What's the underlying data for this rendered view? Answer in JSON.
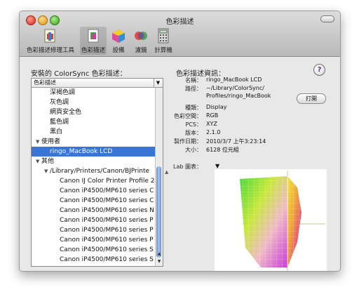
{
  "window": {
    "title": "色彩描述"
  },
  "toolbar": [
    {
      "name": "toolbar-profile-first-aid",
      "label": "色彩描述修理工具"
    },
    {
      "name": "toolbar-profiles",
      "label": "色彩描述"
    },
    {
      "name": "toolbar-devices",
      "label": "設備"
    },
    {
      "name": "toolbar-filters",
      "label": "濾鏡"
    },
    {
      "name": "toolbar-calculator",
      "label": "計算機"
    }
  ],
  "left": {
    "heading": "安裝的 ColorSync 色彩描述：",
    "popup_value": "色彩描述",
    "rows": [
      {
        "text": "深褐色調",
        "indent": 26,
        "disc": ""
      },
      {
        "text": "灰色調",
        "indent": 26,
        "disc": ""
      },
      {
        "text": "網頁安全色",
        "indent": 26,
        "disc": ""
      },
      {
        "text": "藍色調",
        "indent": 26,
        "disc": ""
      },
      {
        "text": "黑白",
        "indent": 26,
        "disc": ""
      },
      {
        "text": "使用者",
        "indent": 6,
        "disc": "▼"
      },
      {
        "text": "ringo_MacBook LCD",
        "indent": 26,
        "disc": "",
        "selected": true
      },
      {
        "text": "其他",
        "indent": 6,
        "disc": "▼"
      },
      {
        "text": "/Library/Printers/Canon/BJPrinte",
        "indent": 18,
        "disc": "▼"
      },
      {
        "text": "Canon IJ Color Printer Profile 2",
        "indent": 40,
        "disc": ""
      },
      {
        "text": "Canon iP4500/MP610 series C",
        "indent": 40,
        "disc": ""
      },
      {
        "text": "Canon iP4500/MP610 series C",
        "indent": 40,
        "disc": ""
      },
      {
        "text": "Canon iP4500/MP610 series N",
        "indent": 40,
        "disc": ""
      },
      {
        "text": "Canon iP4500/MP610 series P",
        "indent": 40,
        "disc": ""
      },
      {
        "text": "Canon iP4500/MP610 series P",
        "indent": 40,
        "disc": ""
      },
      {
        "text": "Canon iP4500/MP610 series P",
        "indent": 40,
        "disc": ""
      },
      {
        "text": "Canon iP4500/MP610 series S",
        "indent": 40,
        "disc": ""
      },
      {
        "text": "Canon iP4500/MP610 series S",
        "indent": 40,
        "disc": ""
      }
    ]
  },
  "right": {
    "heading": "色彩描述資訊：",
    "help_label": "?",
    "open_button": "打開",
    "fields": {
      "name_label": "名稱：",
      "name_value": "ringo_MacBook LCD",
      "path_label": "路徑：",
      "path_line1": "~/Library/ColorSync/",
      "path_line2": "Profiles/ringo_MacBook",
      "class_label": "種類：",
      "class_value": "Display",
      "space_label": "色彩空間：",
      "space_value": "RGB",
      "pcs_label": "PCS：",
      "pcs_value": "XYZ",
      "version_label": "版本：",
      "version_value": "2.1.0",
      "date_label": "製作日期：",
      "date_value": "2010/3/7 上午3:23:14",
      "size_label": "大小：",
      "size_value": "6128 位元組"
    },
    "lab_label": "Lab 圖表："
  }
}
